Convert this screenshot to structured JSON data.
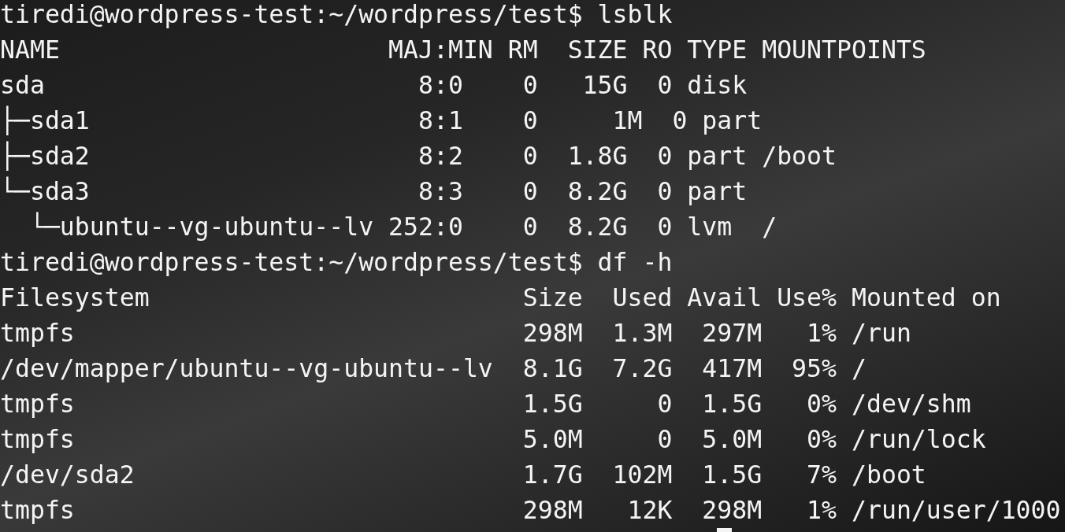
{
  "terminal": {
    "sessions": [
      {
        "prompt": "tiredi@wordpress-test:~/wordpress/test$ lsblk",
        "output": [
          "NAME                      MAJ:MIN RM  SIZE RO TYPE MOUNTPOINTS",
          "sda                         8:0    0   15G  0 disk",
          "├─sda1                      8:1    0     1M  0 part",
          "├─sda2                      8:2    0  1.8G  0 part /boot",
          "└─sda3                      8:3    0  8.2G  0 part",
          "  └─ubuntu--vg-ubuntu--lv 252:0    0  8.2G  0 lvm  /"
        ]
      },
      {
        "prompt": "tiredi@wordpress-test:~/wordpress/test$ df -h",
        "output": [
          "Filesystem                         Size  Used Avail Use% Mounted on",
          "tmpfs                              298M  1.3M  297M   1% /run",
          "/dev/mapper/ubuntu--vg-ubuntu--lv  8.1G  7.2G  417M  95% /",
          "tmpfs                              1.5G     0  1.5G   0% /dev/shm",
          "tmpfs                              5.0M     0  5.0M   0% /run/lock",
          "/dev/sda2                          1.7G  102M  1.5G   7% /boot",
          "tmpfs                              298M   12K  298M   1% /run/user/1000"
        ]
      }
    ]
  }
}
